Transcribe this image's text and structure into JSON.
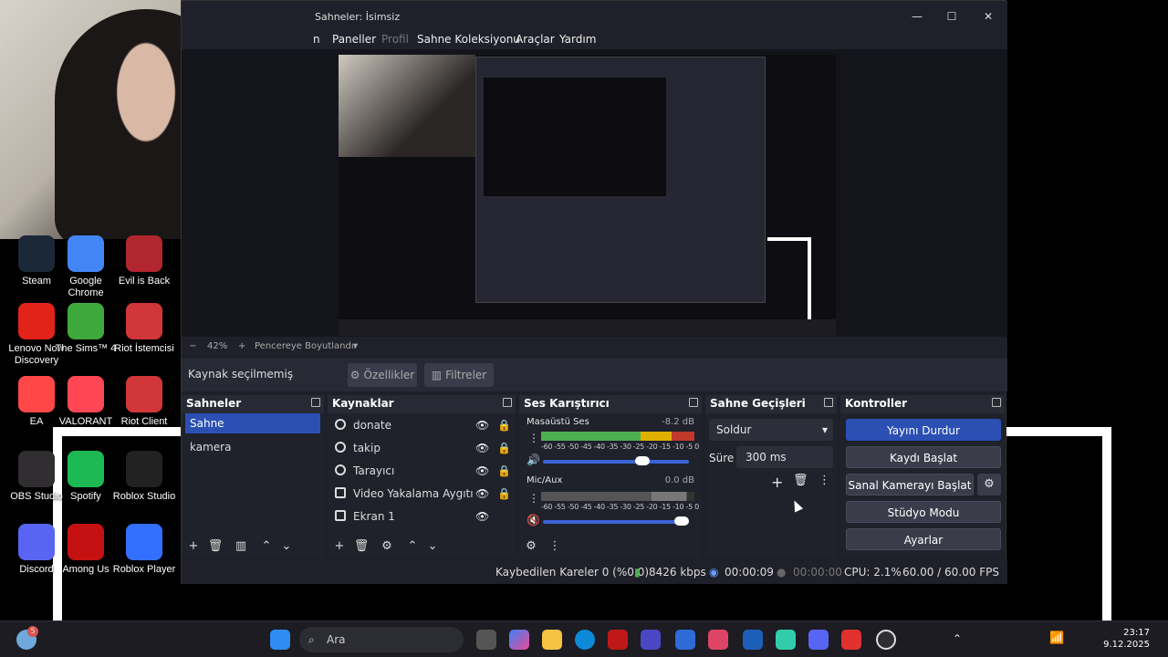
{
  "window": {
    "title": "Sahneler: İsimsiz"
  },
  "menu": {
    "items": [
      "n",
      "Paneller",
      "Profil",
      "Sahne Koleksiyonu",
      "Araçlar",
      "Yardım"
    ]
  },
  "desktop_icons": [
    {
      "label": "Steam",
      "color": "#1b2838"
    },
    {
      "label": "Google Chrome",
      "color": "#4285f4"
    },
    {
      "label": "Evil is Back",
      "color": "#b2262f"
    },
    {
      "label": "Lenovo Now Discovery",
      "color": "#e2231a"
    },
    {
      "label": "The Sims™ 4",
      "color": "#3fa83c"
    },
    {
      "label": "Riot İstemcisi",
      "color": "#d13639"
    },
    {
      "label": "EA",
      "color": "#ff4747"
    },
    {
      "label": "VALORANT",
      "color": "#ff4655"
    },
    {
      "label": "Riot Client",
      "color": "#d13639"
    },
    {
      "label": "OBS Studio",
      "color": "#302e31"
    },
    {
      "label": "Spotify",
      "color": "#1db954"
    },
    {
      "label": "Roblox Studio",
      "color": "#222"
    },
    {
      "label": "Discord",
      "color": "#5865f2"
    },
    {
      "label": "Among Us",
      "color": "#c51111"
    },
    {
      "label": "Roblox Player",
      "color": "#3370ff"
    }
  ],
  "zoom": {
    "minus": "−",
    "level": "42%",
    "plus": "+",
    "fit": "Pencereye Boyutlandır"
  },
  "source_toolbar": {
    "no_selection": "Kaynak seçilmemiş",
    "properties": "Özellikler",
    "filters": "Filtreler"
  },
  "scenes": {
    "title": "Sahneler",
    "items": [
      "Sahne",
      "kamera"
    ]
  },
  "sources": {
    "title": "Kaynaklar",
    "items": [
      "donate",
      "takip",
      "Tarayıcı",
      "Video Yakalama Aygıtı",
      "Ekran 1"
    ]
  },
  "mixer": {
    "title": "Ses Karıştırıcı",
    "channels": [
      {
        "name": "Masaüstü Ses",
        "db": "-8.2 dB",
        "volume": 0.7
      },
      {
        "name": "Mic/Aux",
        "db": "0.0 dB",
        "volume": 1.0
      }
    ],
    "scale": "-60 -55 -50 -45 -40 -35 -30 -25 -20 -15 -10 -5 0"
  },
  "transitions": {
    "title": "Sahne Geçişleri",
    "selected": "Soldur",
    "duration_label": "Süre",
    "duration": "300 ms"
  },
  "controls": {
    "title": "Kontroller",
    "buttons": [
      "Yayını Durdur",
      "Kaydı Başlat",
      "Sanal Kamerayı Başlat",
      "Stüdyo Modu",
      "Ayarlar"
    ]
  },
  "status": {
    "dropped": "Kaybedilen Kareler 0 (%0.0)",
    "bitrate": "8426 kbps",
    "stream_time": "00:00:09",
    "rec_time": "00:00:00",
    "cpu": "CPU: 2.1%",
    "fps": "60.00 / 60.00 FPS"
  },
  "taskbar": {
    "search": "Ara",
    "time": "23:17",
    "date": "9.12.2025",
    "badge": "5"
  }
}
